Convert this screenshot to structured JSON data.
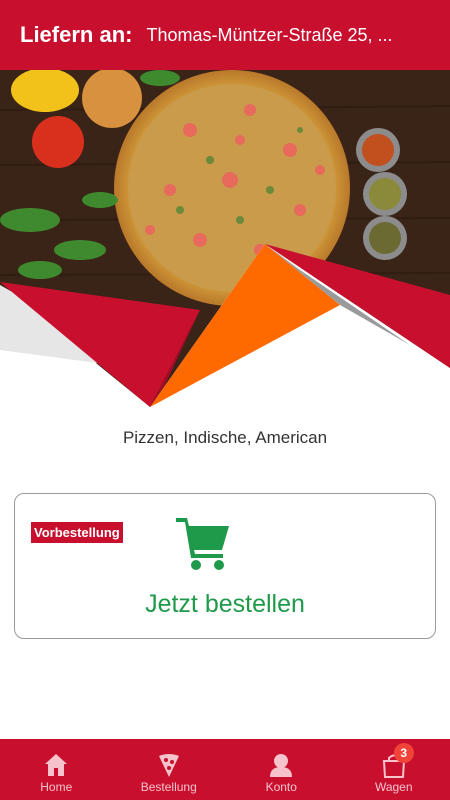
{
  "header": {
    "label": "Liefern an:",
    "address": "Thomas-Müntzer-Straße 25, ..."
  },
  "hero": {
    "image": "pizza-banner",
    "accent_colors": {
      "red": "#c8102e",
      "orange": "#ff6a00"
    }
  },
  "restaurant": {
    "cuisines": "Pizzen, Indische, American"
  },
  "order_card": {
    "badge": "Vorbestellung",
    "icon": "shopping-cart-icon",
    "label": "Jetzt bestellen",
    "color": "#1f9a4a"
  },
  "nav": {
    "items": [
      {
        "label": "Home",
        "icon": "home-icon"
      },
      {
        "label": "Bestellung",
        "icon": "pizza-slice-icon"
      },
      {
        "label": "Konto",
        "icon": "user-icon"
      },
      {
        "label": "Wagen",
        "icon": "shopping-bag-icon"
      }
    ],
    "cart_count": "3"
  },
  "colors": {
    "primary": "#c8102e",
    "nav_text": "#f6c3cc",
    "badge_red": "#f0433a"
  }
}
